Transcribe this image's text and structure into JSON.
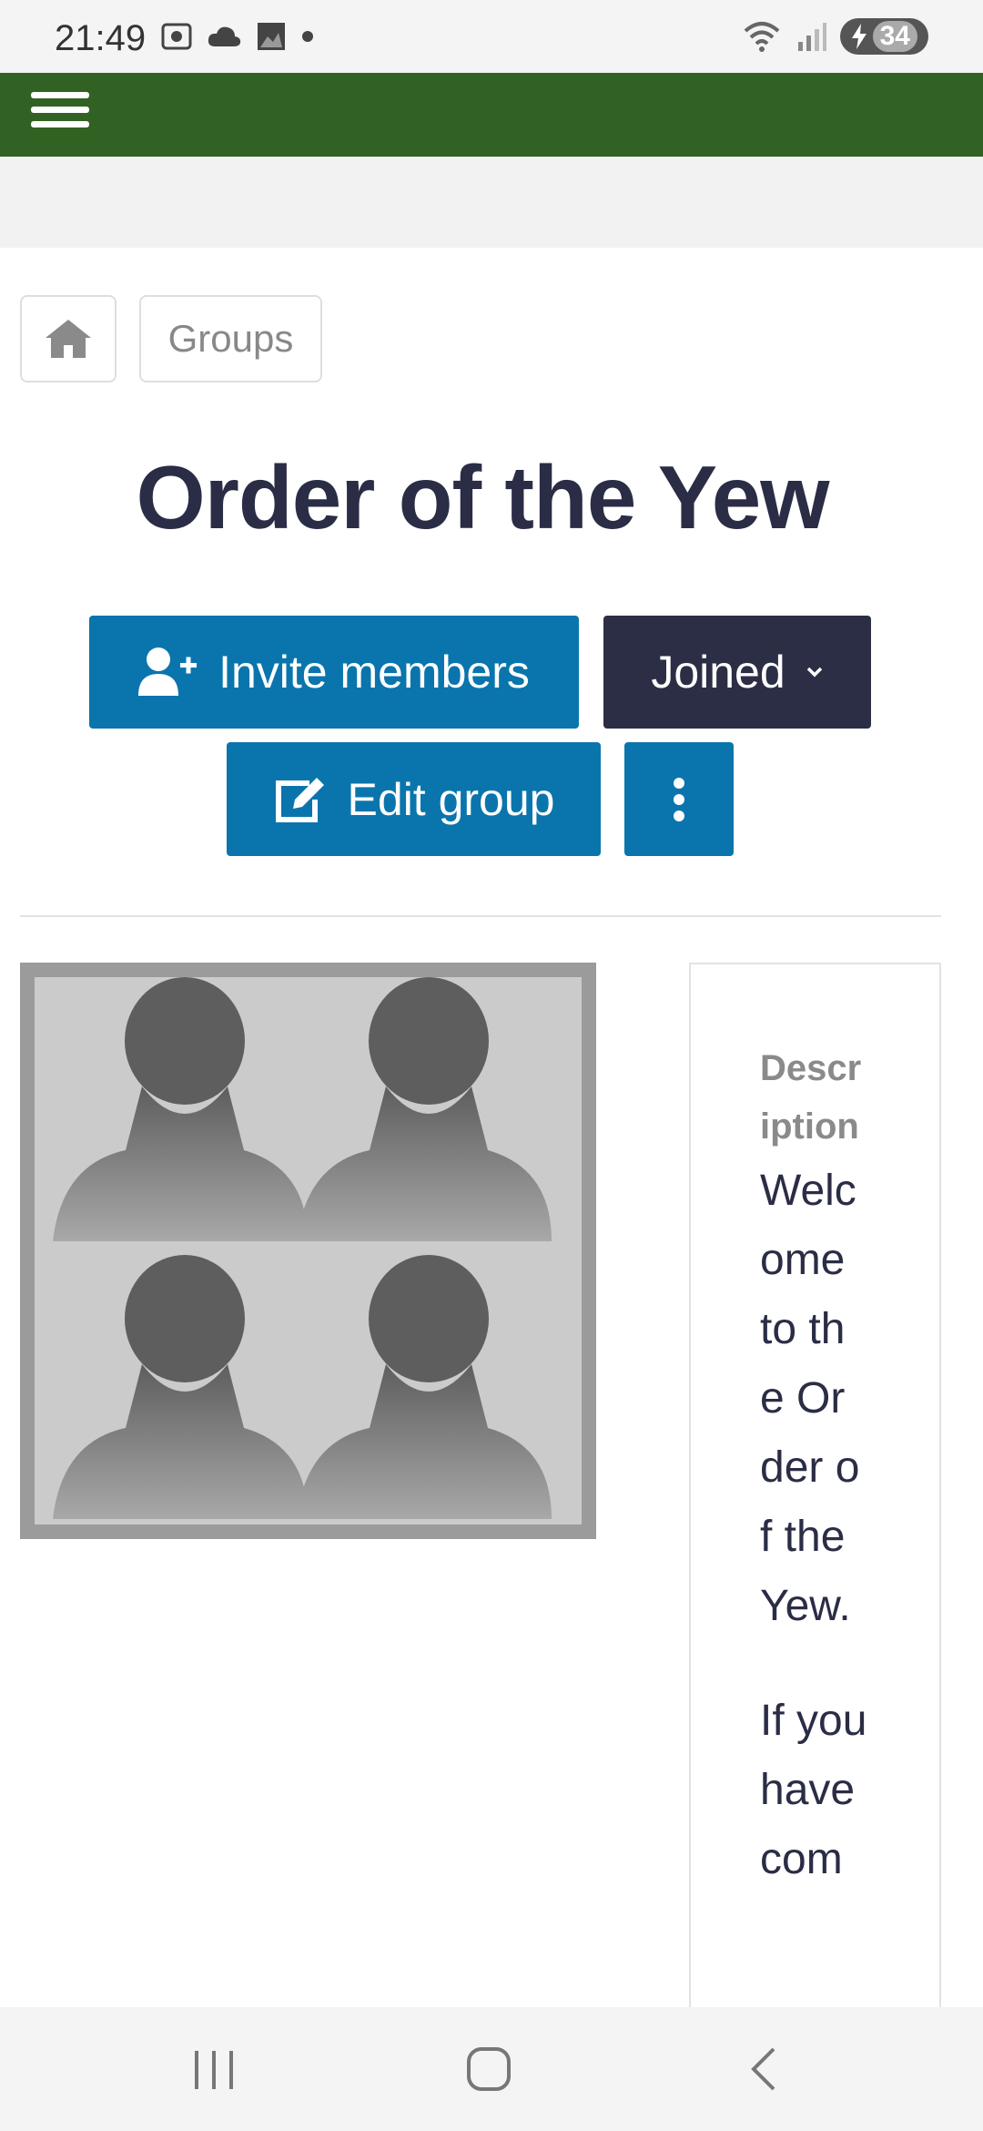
{
  "status_bar": {
    "time": "21:49",
    "battery": "34"
  },
  "breadcrumb": {
    "groups_label": "Groups"
  },
  "page": {
    "title": "Order of the Yew"
  },
  "actions": {
    "invite_label": "Invite members",
    "joined_label": "Joined",
    "edit_label": "Edit group"
  },
  "description": {
    "label": "Description",
    "paragraphs": [
      "Welcome to the Order of the Yew.",
      "If you have com"
    ]
  },
  "colors": {
    "nav": "#326223",
    "primary": "#0a75ad",
    "dark": "#2c2e45"
  }
}
